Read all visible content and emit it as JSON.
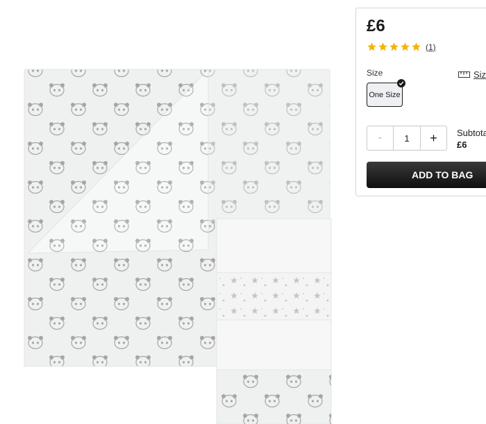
{
  "product": {
    "image_alt": "Muslin squares with panda print",
    "price": "£6",
    "rating": 5,
    "rating_count": "(1)",
    "star_color": "#f4b400",
    "size_label": "Size",
    "size_guide_label": "Size",
    "size_options": [
      "One Size"
    ],
    "selected_size": "One Size",
    "quantity": "1",
    "minus_label": "-",
    "plus_label": "+",
    "subtotal_label": "Subtotal",
    "subtotal_value": "£6",
    "add_to_bag_label": "ADD TO BAG"
  },
  "colors": {
    "button_bg": "#1a1a1a",
    "panel_border": "#d6d6d6",
    "muslin": "#eef1ef",
    "print": "#9a9a9a"
  }
}
